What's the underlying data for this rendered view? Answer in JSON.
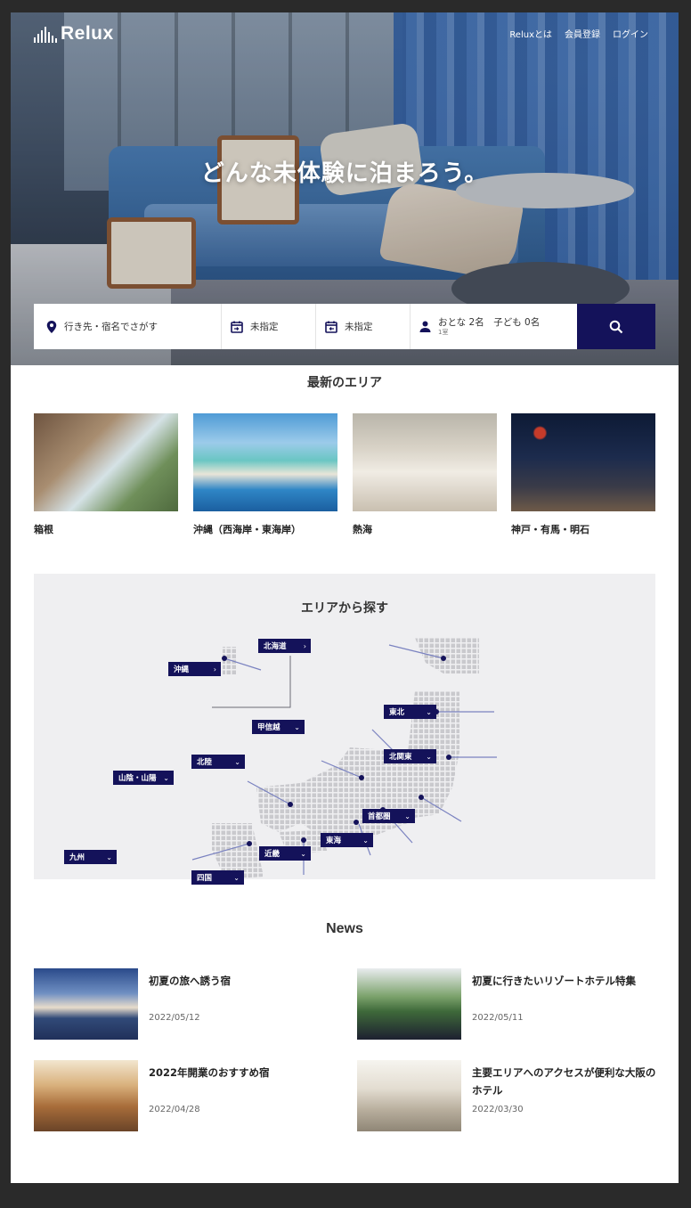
{
  "header": {
    "logo_text": "Relux",
    "nav": [
      "Reluxとは",
      "会員登録",
      "ログイン"
    ]
  },
  "hero": {
    "headline": "どんな未体験に泊まろう。"
  },
  "search": {
    "destination_placeholder": "行き先・宿名でさがす",
    "checkin": "未指定",
    "checkout": "未指定",
    "guests": "おとな 2名　子ども 0名",
    "rooms": "1室",
    "button_icon": "search-icon"
  },
  "latest_areas": {
    "title": "最新のエリア",
    "items": [
      {
        "label": "箱根"
      },
      {
        "label": "沖縄（西海岸・東海岸）"
      },
      {
        "label": "熱海"
      },
      {
        "label": "神戸・有馬・明石"
      }
    ]
  },
  "area_search": {
    "title": "エリアから探す",
    "regions": {
      "hokkaido": "北海道",
      "okinawa": "沖縄",
      "koshinetsu": "甲信越",
      "tohoku": "東北",
      "hokuriku": "北陸",
      "kitakanto": "北関東",
      "sanin_sanyo": "山陰・山陽",
      "shutoken": "首都圏",
      "tokai": "東海",
      "kinki": "近畿",
      "kyushu": "九州",
      "shikoku": "四国"
    }
  },
  "news": {
    "title": "News",
    "items": [
      {
        "title": "初夏の旅へ誘う宿",
        "date": "2022/05/12"
      },
      {
        "title": "初夏に行きたいリゾートホテル特集",
        "date": "2022/05/11"
      },
      {
        "title": "2022年開業のおすすめ宿",
        "date": "2022/04/28"
      },
      {
        "title": "主要エリアへのアクセスが便利な大阪のホテル",
        "date": "2022/03/30"
      }
    ]
  },
  "colors": {
    "accent": "#14125a",
    "map_bg": "#efeff1",
    "page_bg": "#2a2a2a"
  }
}
